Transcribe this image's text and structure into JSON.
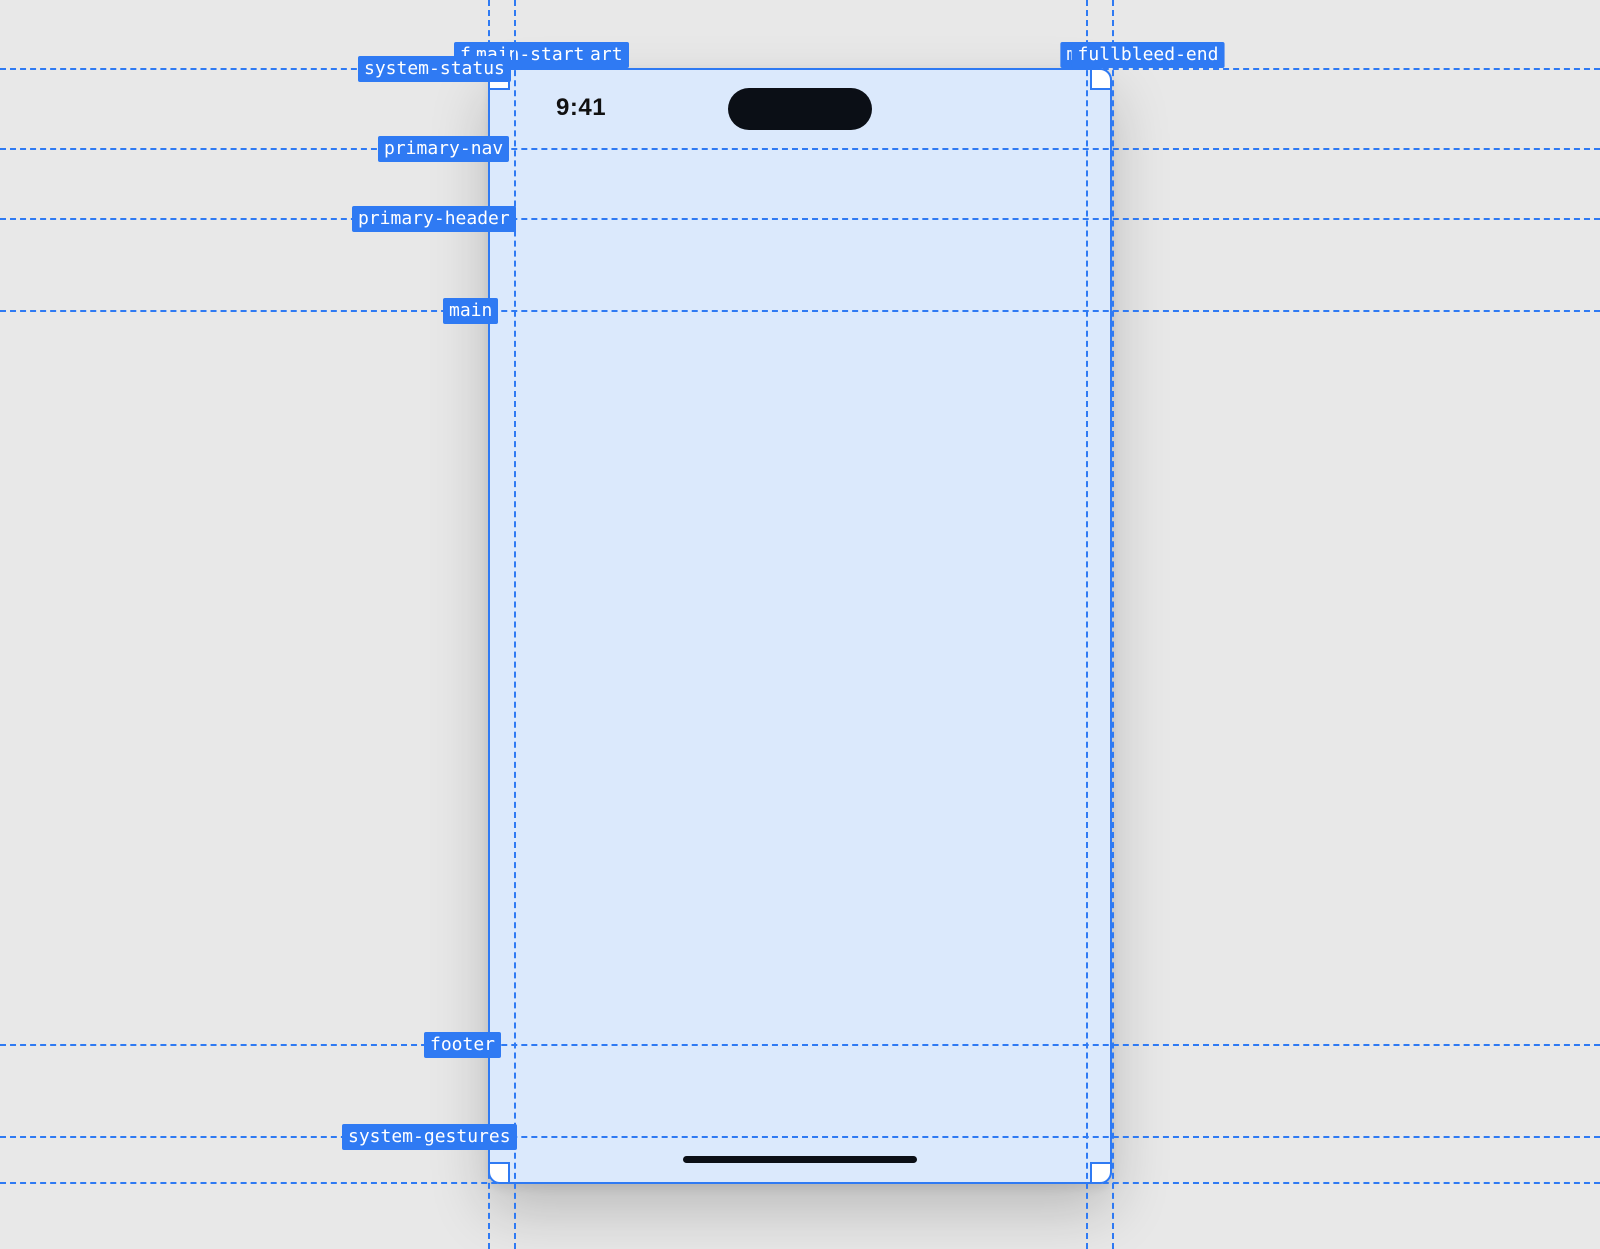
{
  "status": {
    "time": "9:41"
  },
  "guides": {
    "vertical": {
      "fullbleed_start": {
        "label": "fullbleed-start",
        "label2": "main-start"
      },
      "main_end": {
        "label": "main-end"
      },
      "fullbleed_end": {
        "label": "fullbleed-end"
      }
    },
    "horizontal": {
      "system_status": {
        "label": "system-status"
      },
      "primary_nav": {
        "label": "primary-nav"
      },
      "primary_header": {
        "label": "primary-header"
      },
      "main": {
        "label": "main"
      },
      "footer": {
        "label": "footer"
      },
      "system_gestures": {
        "label": "system-gestures"
      }
    }
  }
}
